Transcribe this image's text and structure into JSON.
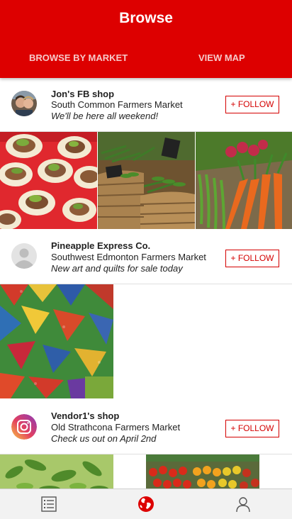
{
  "header": {
    "title": "Browse",
    "tabs": [
      {
        "label": "BROWSE BY MARKET"
      },
      {
        "label": "VIEW MAP"
      }
    ]
  },
  "vendors": [
    {
      "name": "Jon's FB shop",
      "market": "South Common Farmers Market",
      "note": "We'll be here all weekend!",
      "follow_label": "+ FOLLOW",
      "avatar": "couple-photo"
    },
    {
      "name": "Pineapple Express Co.",
      "market": "Southwest Edmonton Farmers Market",
      "note": "New art and quilts for sale today",
      "follow_label": "+ FOLLOW",
      "avatar": "default-user-avatar"
    },
    {
      "name": "Vendor1's shop",
      "market": "Old Strathcona Farmers Market",
      "note": "Check us out on April 2nd",
      "follow_label": "+ FOLLOW",
      "avatar": "camera-app-icon"
    }
  ],
  "bottom_nav": {
    "items": [
      {
        "icon": "list-icon"
      },
      {
        "icon": "globe-icon",
        "active": true
      },
      {
        "icon": "profile-icon"
      }
    ]
  },
  "colors": {
    "brand_red": "#dd0000",
    "tab_text": "#f6c9c9",
    "follow_red": "#d40000"
  }
}
